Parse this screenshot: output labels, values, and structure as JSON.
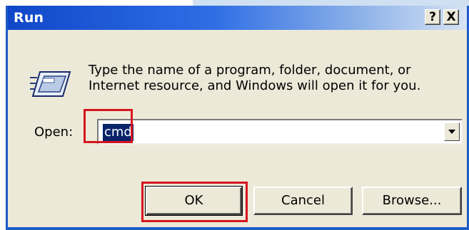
{
  "window": {
    "title": "Run",
    "help_label": "?",
    "close_label": "X"
  },
  "description": {
    "line1": "Type the name of a program, folder, document, or",
    "line2": "Internet resource, and Windows will open it for you."
  },
  "open": {
    "label": "Open:",
    "value": "cmd"
  },
  "buttons": {
    "ok": "OK",
    "cancel": "Cancel",
    "browse": "Browse..."
  },
  "icons": {
    "run": "run-icon",
    "dropdown": "chevron-down-icon"
  },
  "colors": {
    "title_bar": "#1047c9",
    "dialog_bg": "#ece9d8",
    "highlight": "#d6151f",
    "selection": "#0a246a"
  }
}
